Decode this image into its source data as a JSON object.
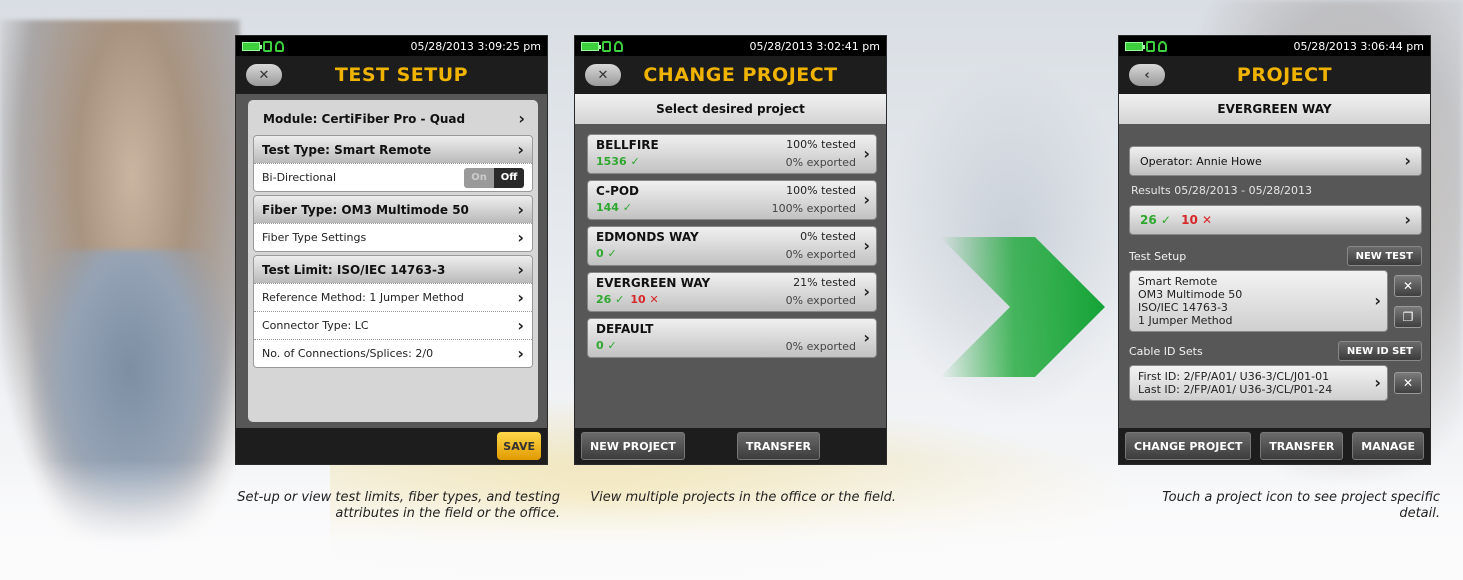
{
  "colors": {
    "accent_title": "#f0b400",
    "pass_green": "#2ea82e",
    "fail_red": "#d62828",
    "arrow_green": "#1faa3a"
  },
  "screen1": {
    "timestamp": "05/28/2013 3:09:25 pm",
    "back_label": "✕",
    "title": "TEST SETUP",
    "module": "Module: CertiFiber Pro - Quad",
    "test_type": "Test Type: Smart Remote",
    "bidirectional_label": "Bi-Directional",
    "toggle_on": "On",
    "toggle_off": "Off",
    "fiber_type": "Fiber Type: OM3 Multimode 50",
    "fiber_type_settings": "Fiber Type Settings",
    "test_limit": "Test Limit: ISO/IEC 14763-3",
    "reference_method": "Reference Method: 1 Jumper Method",
    "connector_type": "Connector Type: LC",
    "connections": "No. of Connections/Splices: 2/0",
    "save_label": "SAVE"
  },
  "screen2": {
    "timestamp": "05/28/2013 3:02:41 pm",
    "back_label": "✕",
    "title": "CHANGE PROJECT",
    "subheader": "Select desired project",
    "projects": [
      {
        "name": "BELLFIRE",
        "count": "1536 ✓",
        "fail": "",
        "tested": "100% tested",
        "exported": "0% exported"
      },
      {
        "name": "C-POD",
        "count": "144 ✓",
        "fail": "",
        "tested": "100% tested",
        "exported": "100% exported"
      },
      {
        "name": "EDMONDS WAY",
        "count": "0 ✓",
        "fail": "",
        "tested": "0% tested",
        "exported": "0% exported"
      },
      {
        "name": "EVERGREEN WAY",
        "count": "26 ✓",
        "fail": "10 ✕",
        "tested": "21% tested",
        "exported": "0% exported"
      },
      {
        "name": "DEFAULT",
        "count": "0 ✓",
        "fail": "",
        "tested": "",
        "exported": "0% exported"
      }
    ],
    "new_project_label": "NEW PROJECT",
    "transfer_label": "TRANSFER"
  },
  "screen3": {
    "timestamp": "05/28/2013 3:06:44 pm",
    "back_label": "‹",
    "title": "PROJECT",
    "subheader": "EVERGREEN WAY",
    "operator": "Operator: Annie Howe",
    "results": "Results 05/28/2013 - 05/28/2013",
    "pass_count": "26 ✓",
    "fail_count": "10 ✕",
    "test_setup_label": "Test Setup",
    "new_test_label": "NEW TEST",
    "setup_lines": [
      "Smart Remote",
      "OM3 Multimode 50",
      "ISO/IEC 14763-3",
      "1 Jumper Method"
    ],
    "cable_id_label": "Cable ID Sets",
    "new_id_set_label": "NEW ID SET",
    "first_id": "First ID: 2/FP/A01/ U36-3/CL/J01-01",
    "last_id": "Last ID: 2/FP/A01/ U36-3/CL/P01-24",
    "change_project_label": "CHANGE PROJECT",
    "transfer_label": "TRANSFER",
    "manage_label": "MANAGE"
  },
  "captions": {
    "caption1": "Set-up or view test limits, fiber types, and testing attributes in the field or the office.",
    "caption2": "View multiple projects in the office or the field.",
    "caption3": "Touch a project icon to see project specific detail."
  }
}
